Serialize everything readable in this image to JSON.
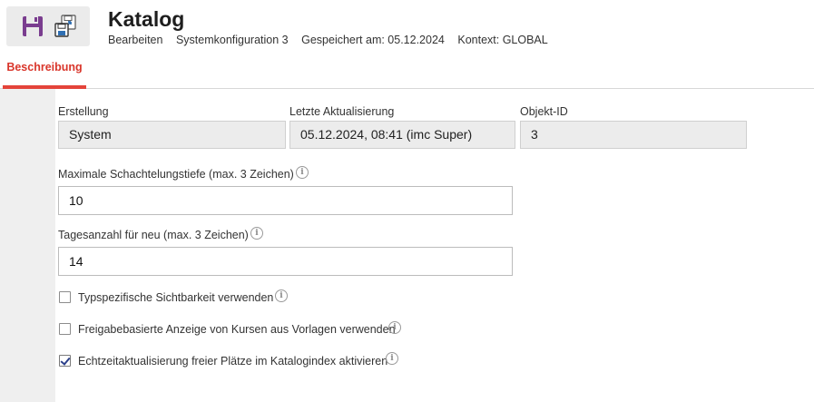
{
  "header": {
    "title": "Katalog",
    "meta": [
      "Bearbeiten",
      "Systemkonfiguration 3",
      "Gespeichert am: 05.12.2024",
      "Kontext: GLOBAL"
    ]
  },
  "toolbar": {
    "save_icon": "floppy-disk-icon",
    "save_as_icon": "save-as-icon",
    "accent": "#7a3d8f"
  },
  "tabs": [
    {
      "label": "Beschreibung",
      "active": true
    }
  ],
  "accent_color": "#e4443a",
  "fields": {
    "erstellung": {
      "label": "Erstellung",
      "value": "System"
    },
    "aktualisierung": {
      "label": "Letzte Aktualisierung",
      "value": "05.12.2024, 08:41 (imc Super)"
    },
    "objekt_id": {
      "label": "Objekt-ID",
      "value": "3"
    },
    "max_tiefe": {
      "label": "Maximale Schachtelungstiefe (max. 3 Zeichen)",
      "value": "10"
    },
    "tagesanzahl": {
      "label": "Tagesanzahl für neu (max. 3 Zeichen)",
      "value": "14"
    }
  },
  "checkboxes": [
    {
      "label": "Typspezifische Sichtbarkeit verwenden",
      "checked": false
    },
    {
      "label": "Freigabebasierte Anzeige von Kursen aus Vorlagen verwenden",
      "checked": false
    },
    {
      "label": "Echtzeitaktualisierung freier Plätze im Katalogindex aktivieren",
      "checked": true
    }
  ],
  "info_icon": "info-icon"
}
